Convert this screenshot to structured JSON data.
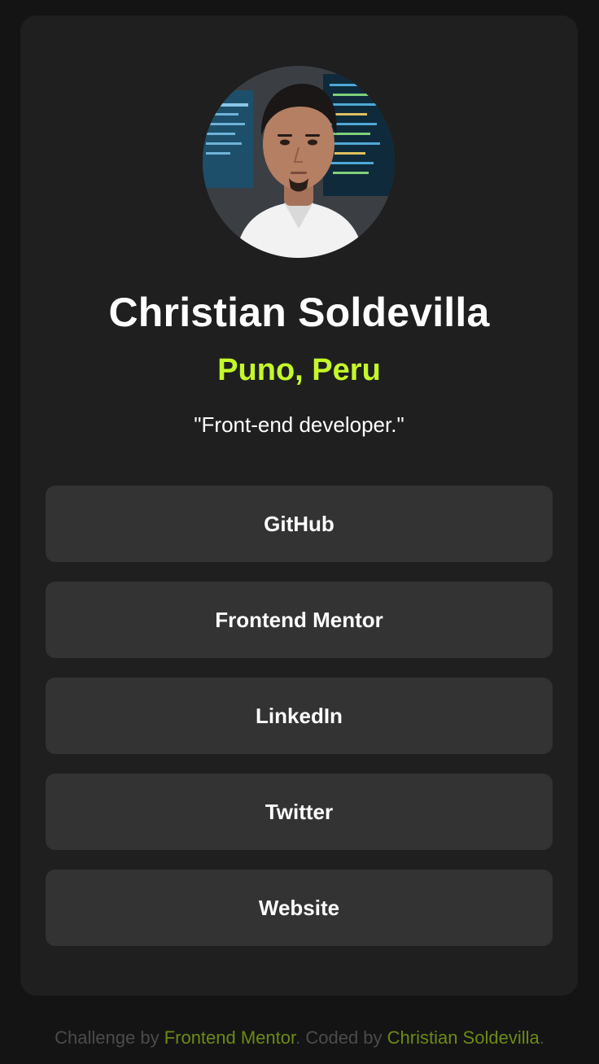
{
  "profile": {
    "avatar_alt": "Christian Soldevilla",
    "name": "Christian Soldevilla",
    "location": "Puno, Peru",
    "bio": "\"Front-end developer.\""
  },
  "links": [
    {
      "label": "GitHub"
    },
    {
      "label": "Frontend Mentor"
    },
    {
      "label": "LinkedIn"
    },
    {
      "label": "Twitter"
    },
    {
      "label": "Website"
    }
  ],
  "attribution": {
    "prefix": "Challenge by ",
    "challenge_link": "Frontend Mentor",
    "middle": ". Coded by ",
    "author_link": "Christian Soldevilla",
    "suffix": "."
  },
  "colors": {
    "background": "#141414",
    "card": "#1f1f1f",
    "button": "#333333",
    "accent": "#c4f82a",
    "text": "#ffffff"
  }
}
